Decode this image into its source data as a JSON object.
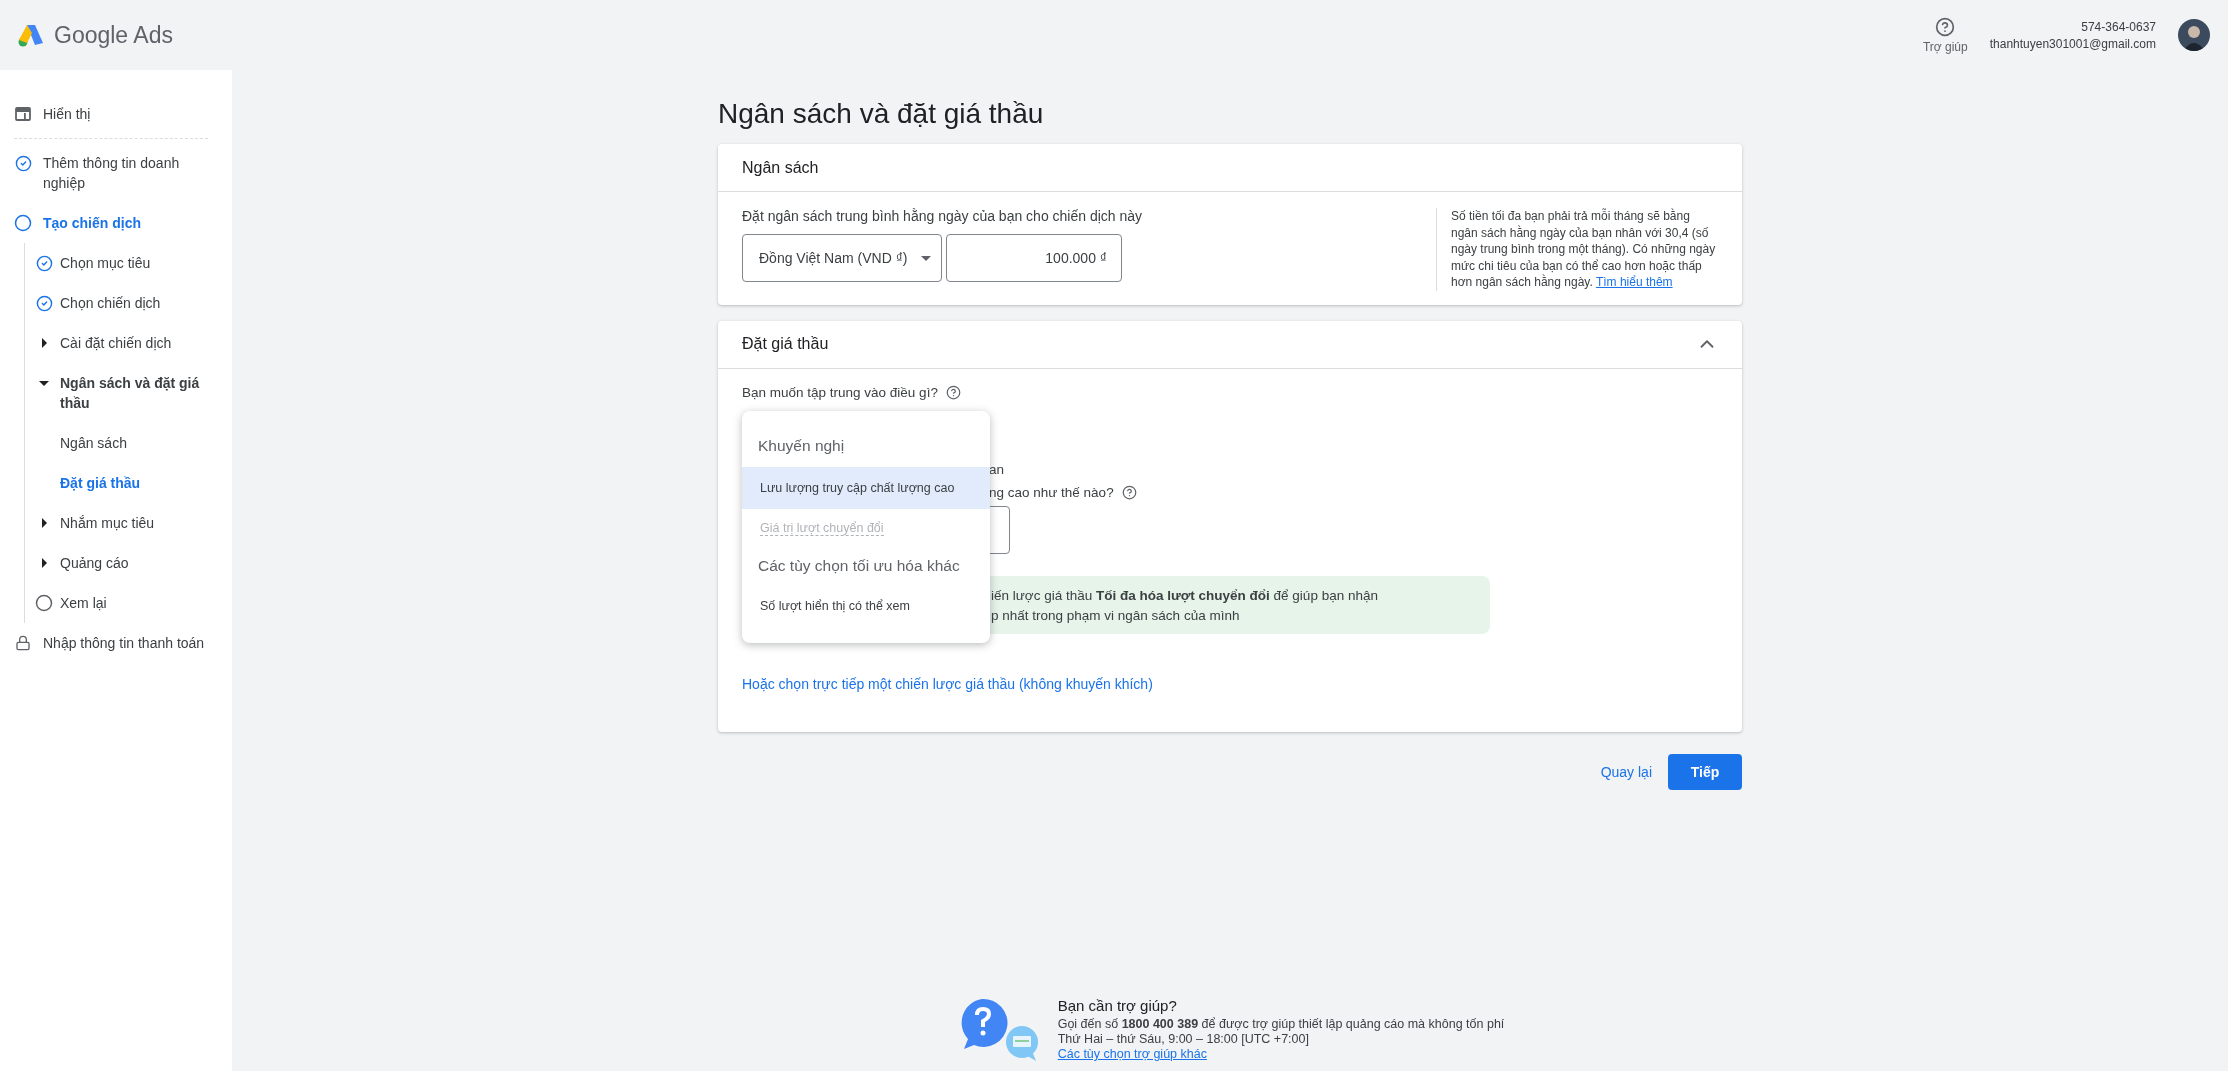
{
  "header": {
    "logo_text": "Google Ads",
    "help_label": "Trợ giúp",
    "account_id": "574-364-0637",
    "email": "thanhtuyen301001@gmail.com"
  },
  "sidebar": {
    "items": [
      {
        "kind": "layout",
        "label": "Hiển thị",
        "selected": false
      },
      {
        "kind": "check",
        "label": "Thêm thông tin doanh nghiệp",
        "selected": false
      },
      {
        "kind": "circle",
        "label": "Tạo chiến dịch",
        "selected": true,
        "children": [
          {
            "kind": "check",
            "label": "Chọn mục tiêu",
            "selected": false
          },
          {
            "kind": "check",
            "label": "Chọn chiến dịch",
            "selected": false
          },
          {
            "kind": "arrow",
            "label": "Cài đặt chiến dịch",
            "selected": false,
            "expanded": false
          },
          {
            "kind": "arrow",
            "label": "Ngân sách và đặt giá thầu",
            "selected": false,
            "expanded": true,
            "children": [
              {
                "label": "Ngân sách",
                "selected": false
              },
              {
                "label": "Đặt giá thầu",
                "selected": true
              }
            ]
          },
          {
            "kind": "arrow",
            "label": "Nhắm mục tiêu",
            "selected": false,
            "expanded": false
          },
          {
            "kind": "arrow",
            "label": "Quảng cáo",
            "selected": false,
            "expanded": false
          },
          {
            "kind": "circle",
            "label": "Xem lại",
            "selected": false
          }
        ]
      },
      {
        "kind": "lock",
        "label": "Nhập thông tin thanh toán",
        "selected": false
      }
    ]
  },
  "page_title": "Ngân sách và đặt giá thầu",
  "budget": {
    "title": "Ngân sách",
    "prompt": "Đặt ngân sách trung bình hằng ngày của bạn cho chiến dịch này",
    "currency": "Đồng Việt Nam (VND ₫)",
    "amount": "100.000 ₫",
    "note": "Số tiền tối đa bạn phải trả mỗi tháng sẽ bằng ngân sách hằng ngày của bạn nhân với 30,4 (số ngày trung bình trong một tháng). Có những ngày mức chi tiêu của bạn có thể cao hơn hoặc thấp hơn ngân sách hằng ngày.",
    "note_link": "Tìm hiểu thêm"
  },
  "bidding": {
    "title": "Đặt giá thầu",
    "expanded": true,
    "question": "Bạn muốn tập trung vào điều gì?",
    "partial_text": "an",
    "partial_question": "ng cao như thế nào?",
    "info_lines": [
      "iến lược giá thầu **Tối đa hóa lượt chuyển đổi** để giúp bạn nhận",
      "p nhất trong phạm vi ngân sách của mình"
    ],
    "link": "Hoặc chọn trực tiếp một chiến lược giá thầu (không khuyến khích)",
    "dropdown": [
      {
        "kind": "header",
        "label": "Khuyến nghị"
      },
      {
        "kind": "option",
        "label": "Lưu lượng truy cập chất lượng cao",
        "selected": true,
        "disabled": false
      },
      {
        "kind": "option",
        "label": "Giá trị lượt chuyển đổi",
        "selected": false,
        "disabled": true
      },
      {
        "kind": "header",
        "label": "Các tùy chọn tối ưu hóa khác"
      },
      {
        "kind": "option",
        "label": "Số lượt hiển thị có thể xem",
        "selected": false,
        "disabled": false
      }
    ]
  },
  "actions": {
    "back": "Quay lại",
    "next": "Tiếp"
  },
  "help_footer": {
    "title": "Bạn cần trợ giúp?",
    "line_1": "Gọi đến số **1800 400 389** để được trợ giúp thiết lập quảng cáo mà không tốn phí",
    "line_2": "Thứ Hai – thứ Sáu, 9:00 – 18:00 [UTC +7:00]",
    "link": "Các tùy chọn trợ giúp khác"
  }
}
